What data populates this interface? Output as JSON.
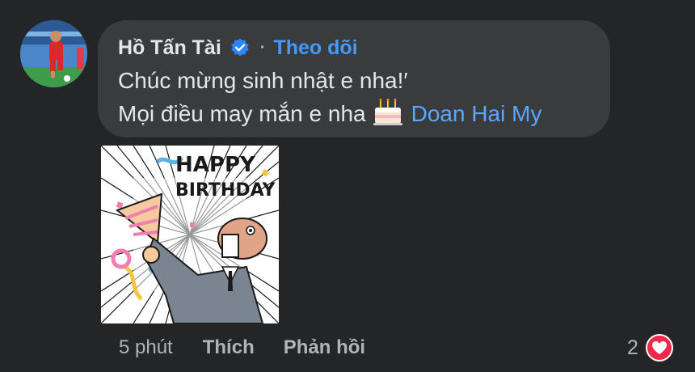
{
  "comment": {
    "author": "Hồ Tấn Tài",
    "separator": "·",
    "follow_label": "Theo dõi",
    "line1": "Chúc mừng sinh nhật e nha!′",
    "line2_text": "Mọi điều may mắn e nha",
    "mention": "Doan Hai My",
    "timestamp": "5 phút",
    "like_label": "Thích",
    "reply_label": "Phản hồi",
    "reaction_count": "2"
  },
  "icons": {
    "verified": "verified-badge-icon",
    "cake": "birthday-cake-emoji",
    "heart": "heart-reaction-icon"
  },
  "sticker": {
    "text": "HAPPY BIRTHDAY"
  },
  "colors": {
    "background": "#242526",
    "bubble": "#3a3b3c",
    "link": "#4599ff",
    "muted": "#b0b3b8",
    "heart": "#f02849"
  }
}
